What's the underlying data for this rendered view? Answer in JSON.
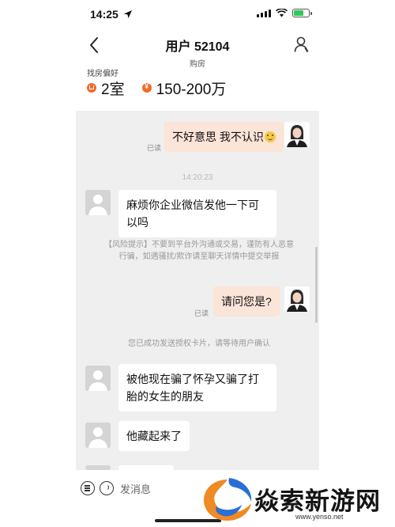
{
  "status_bar": {
    "time": "14:25",
    "battery_color": "#34c759"
  },
  "header": {
    "title": "用户 52104",
    "subtitle": "购房",
    "back_icon": "chevron-left-icon",
    "profile_icon": "user-icon"
  },
  "preferences": {
    "label": "找房偏好",
    "rooms": "2室",
    "budget": "150-200万",
    "accent_color": "#f26a2a"
  },
  "messages": [
    {
      "from": "self",
      "text": "不好意思 我不认识",
      "emoji": "smile-emoji",
      "status": "已读"
    },
    {
      "type": "time",
      "text": "14:20:23"
    },
    {
      "from": "other",
      "text": "麻烦你企业微信发他一下可以吗"
    },
    {
      "type": "notice",
      "text": "【风险提示】不要到平台外沟通或交易，谨防有人恶意行骗，如遇骚扰/欺诈请至聊天详情中提交举报"
    },
    {
      "from": "self",
      "text": "请问您是?",
      "status": "已读"
    },
    {
      "type": "notice",
      "text": "您已成功发送授权卡片，请等待用户确认"
    },
    {
      "from": "other",
      "text": "被他现在骗了怀孕又骗了打胎的女生的朋友"
    },
    {
      "from": "other",
      "text": "他藏起来了"
    }
  ],
  "input_bar": {
    "placeholder": "发消息",
    "menu_icon": "menu-icon",
    "voice_icon": "voice-icon"
  },
  "watermark": {
    "text": "焱索新游网",
    "url": "www.yenso.net",
    "colors": {
      "orange": "#f08a24",
      "blue": "#2a6fd6"
    }
  }
}
